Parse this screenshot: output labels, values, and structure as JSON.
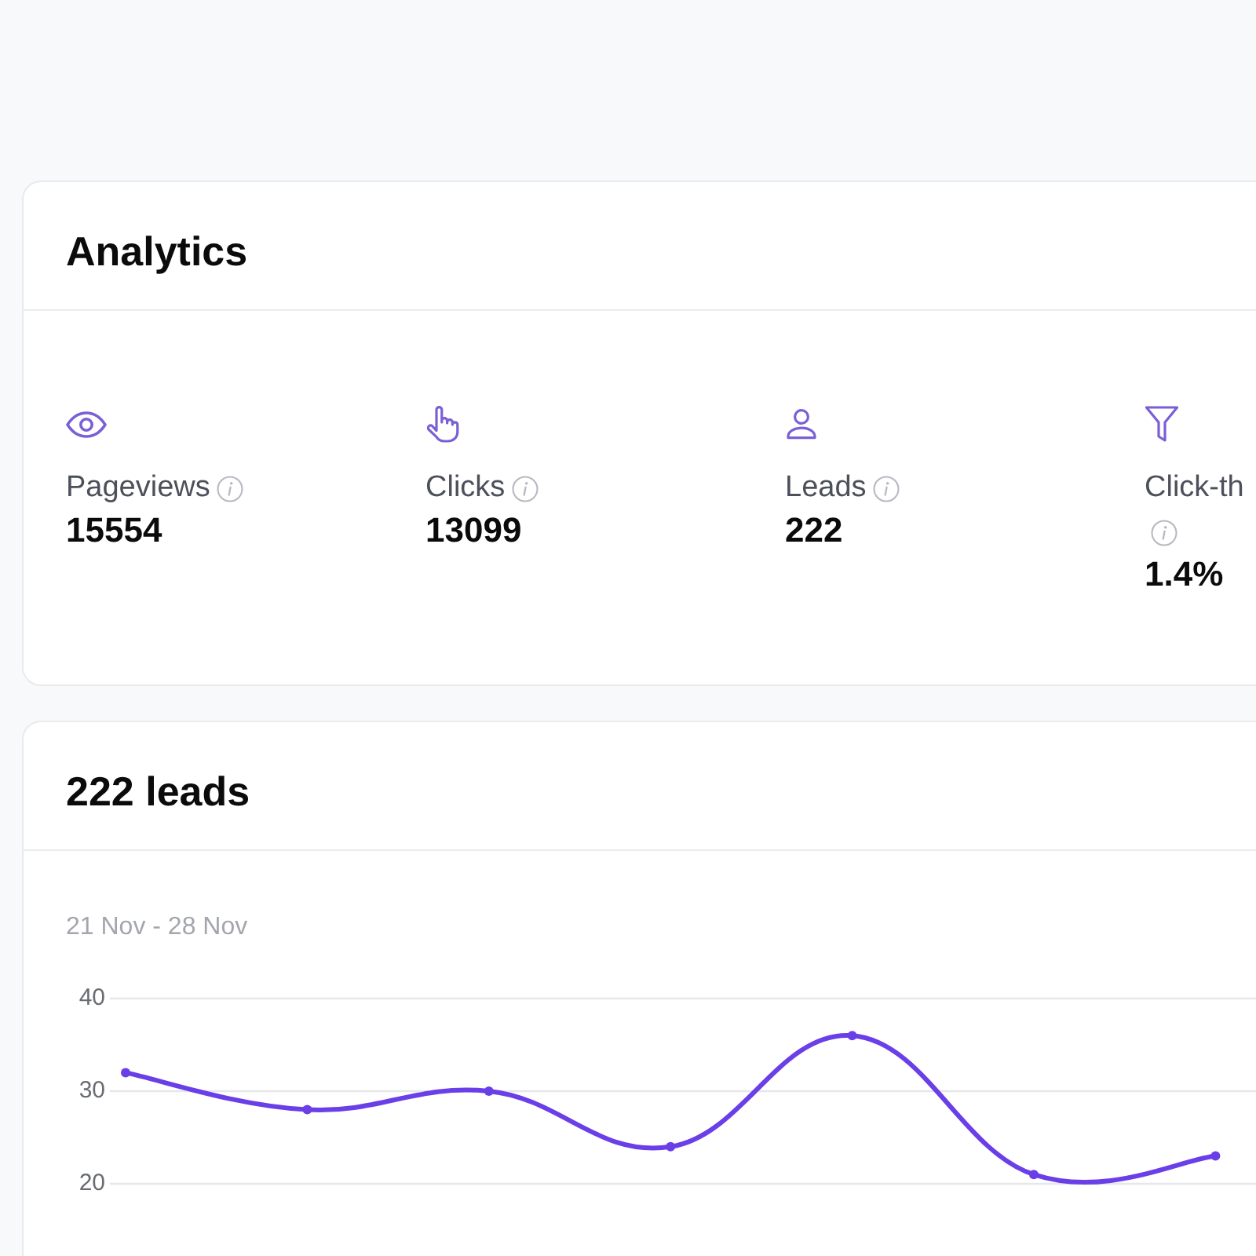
{
  "analytics": {
    "title": "Analytics",
    "stats": [
      {
        "label": "Pageviews",
        "value": "15554"
      },
      {
        "label": "Clicks",
        "value": "13099"
      },
      {
        "label": "Leads",
        "value": "222"
      },
      {
        "label": "Click-th",
        "value": "1.4%"
      }
    ]
  },
  "leads": {
    "title": "222 leads",
    "date_range": "21 Nov - 28 Nov",
    "chart_data": {
      "type": "line",
      "marker": true,
      "ylim": [
        20,
        40
      ],
      "yticks": [
        20,
        30,
        40
      ],
      "values": [
        32,
        28,
        30,
        24,
        36,
        21,
        23
      ]
    }
  }
}
